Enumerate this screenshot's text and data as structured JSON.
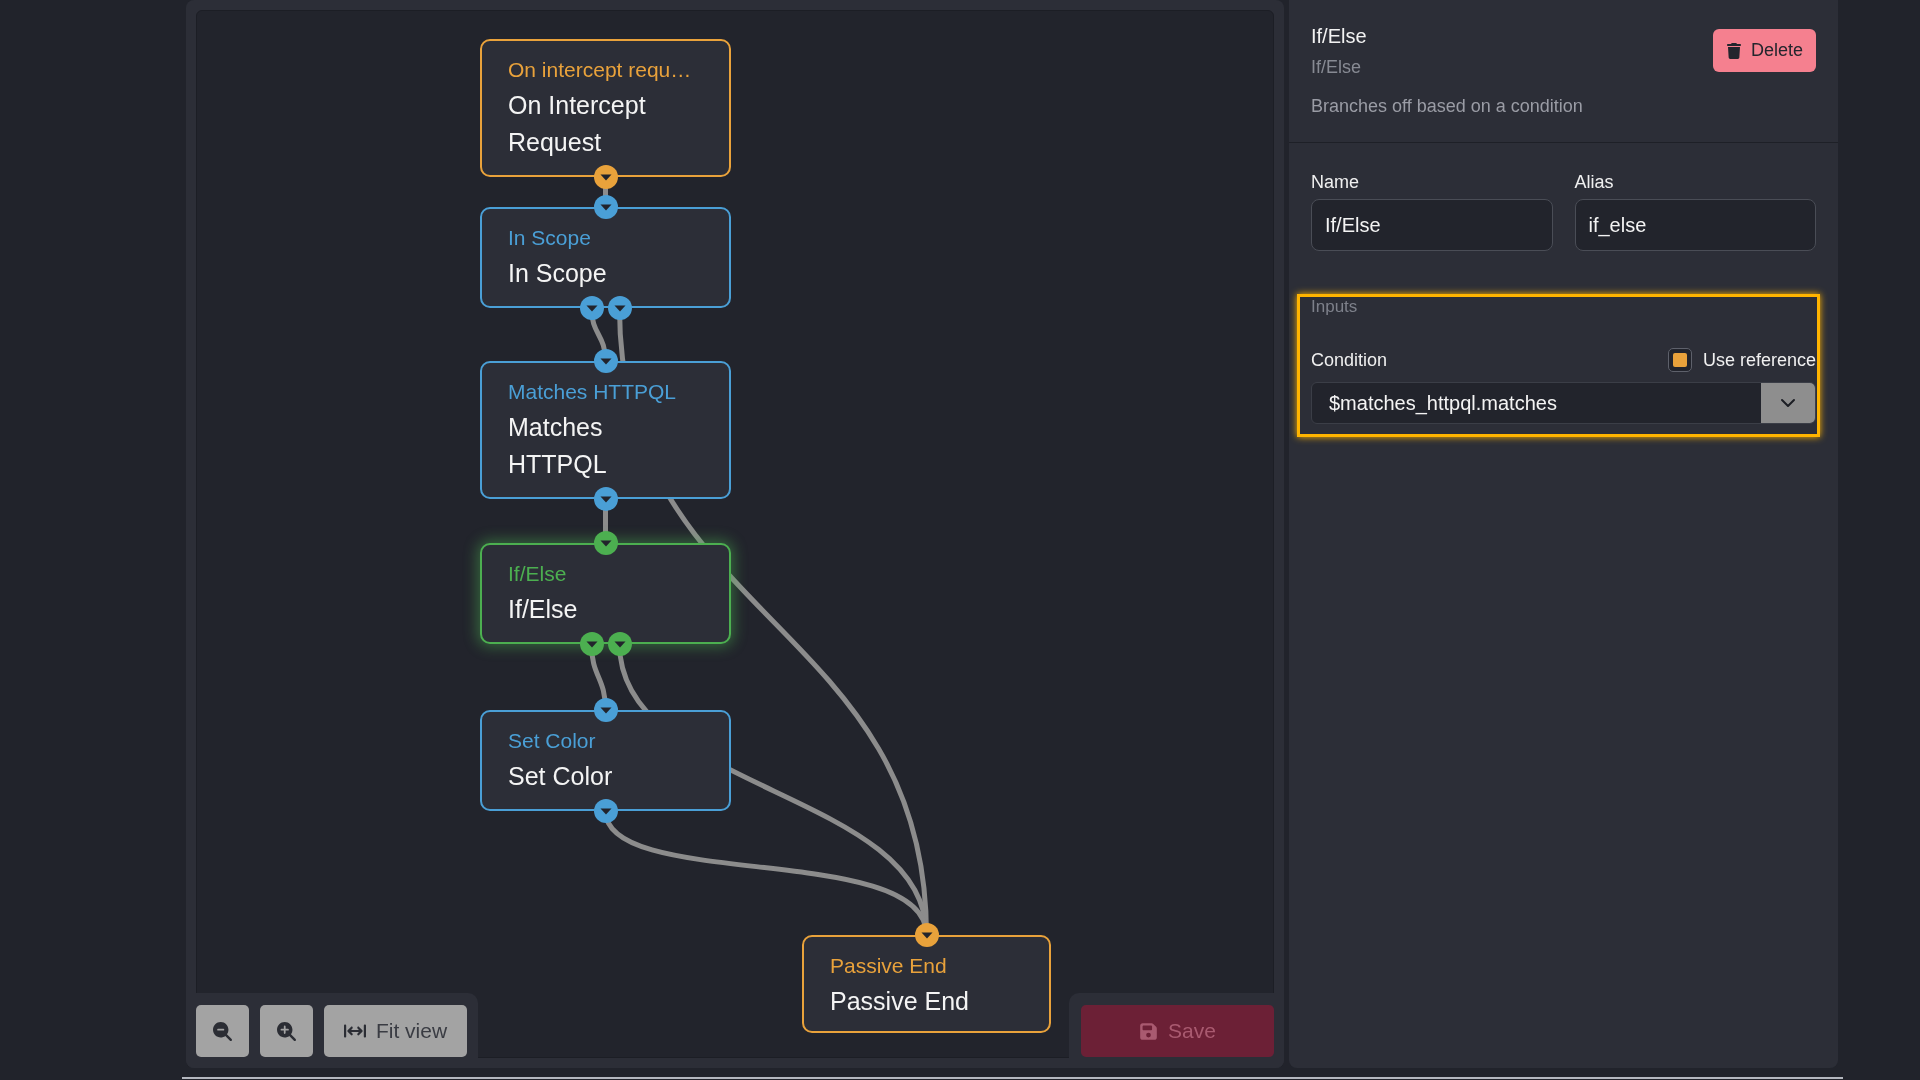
{
  "editor": {
    "nodes": [
      {
        "type_label": "On intercept requ…",
        "name": "On Intercept Request",
        "color": "#e9a23b",
        "selected": false
      },
      {
        "type_label": "In Scope",
        "name": "In Scope",
        "color": "#4a9fd6",
        "selected": false
      },
      {
        "type_label": "Matches HTTPQL",
        "name": "Matches HTTPQL",
        "color": "#4a9fd6",
        "selected": false
      },
      {
        "type_label": "If/Else",
        "name": "If/Else",
        "color": "#4caf50",
        "selected": true
      },
      {
        "type_label": "Set Color",
        "name": "Set Color",
        "color": "#4a9fd6",
        "selected": false
      },
      {
        "type_label": "Passive End",
        "name": "Passive End",
        "color": "#e9a23b",
        "selected": false
      }
    ],
    "fit_view_button": "Fit view",
    "save_button": {
      "label": "Save",
      "disabled": true
    }
  },
  "inspector": {
    "title": "If/Else",
    "subtitle": "If/Else",
    "description": "Branches off based on a condition",
    "delete_button": "Delete",
    "fields": [
      {
        "label": "Name",
        "value": "If/Else"
      },
      {
        "label": "Alias",
        "value": "if_else"
      }
    ],
    "inputs": {
      "heading": "Inputs",
      "highlighted": true,
      "condition": {
        "label": "Condition",
        "use_reference": {
          "label": "Use reference",
          "checked": true
        },
        "value": "$matches_httpql.matches"
      }
    }
  }
}
